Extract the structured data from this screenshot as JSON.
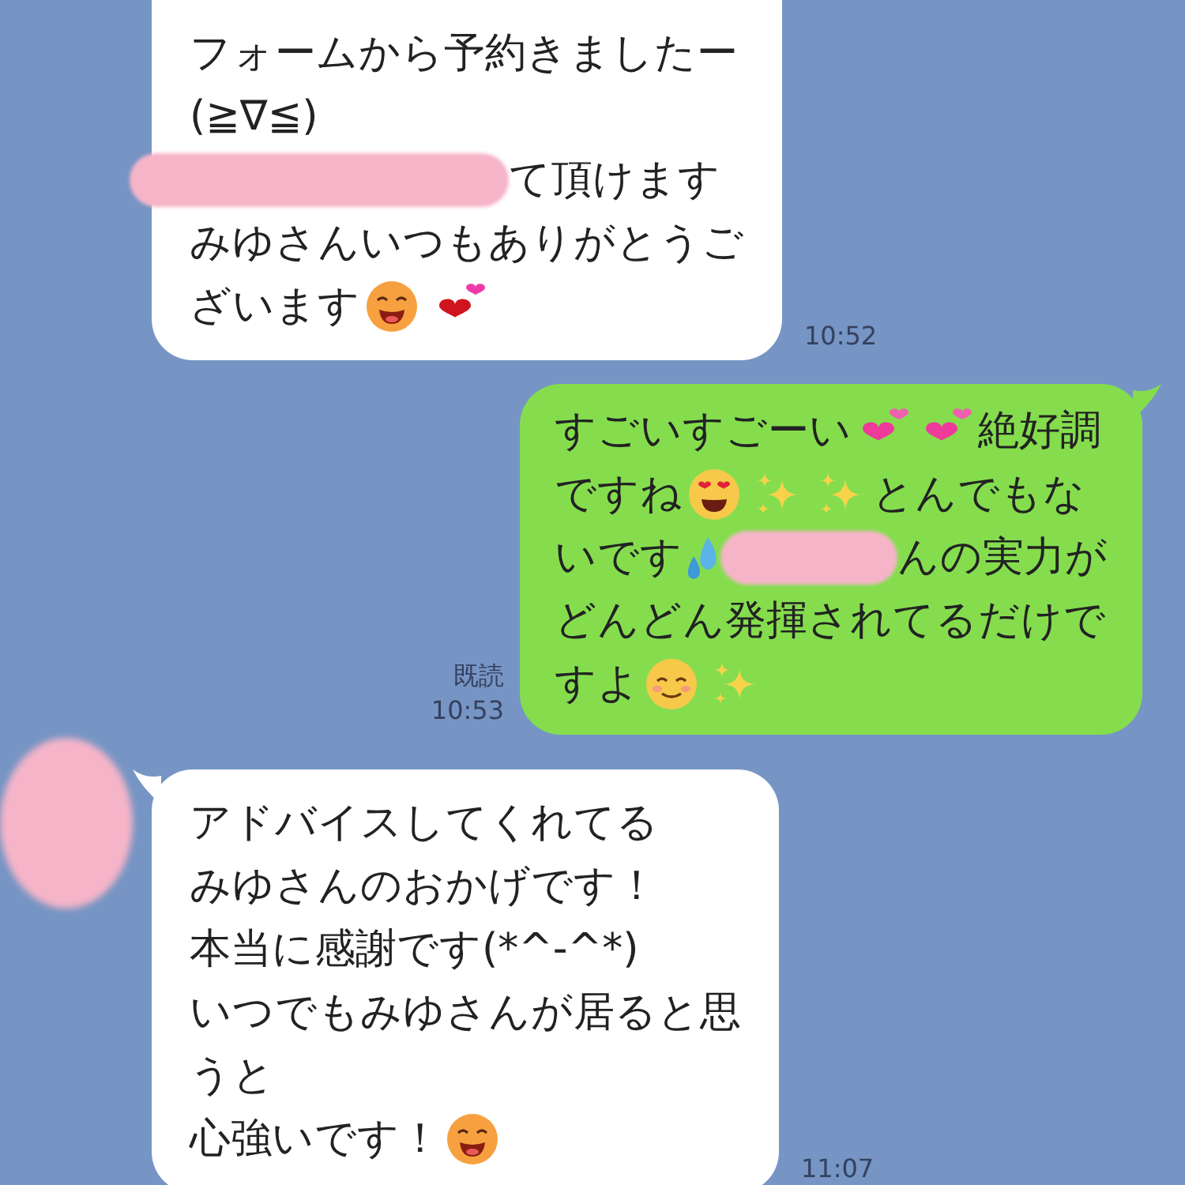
{
  "messages": [
    {
      "kind": "incoming",
      "tail": false,
      "avatar": false,
      "time": "10:52",
      "lines": [
        [
          {
            "kind": "text",
            "text": "フォームから予約きましたー"
          }
        ],
        [
          {
            "kind": "text",
            "text": "(≧∇≦)"
          }
        ],
        [
          {
            "kind": "blot"
          },
          {
            "kind": "text",
            "text": "て頂けます"
          }
        ],
        [
          {
            "kind": "text",
            "text": "みゆさんいつもありがとうご"
          }
        ],
        [
          {
            "kind": "text",
            "text": "ざいます"
          },
          {
            "kind": "grin"
          },
          {
            "kind": "hearts"
          }
        ]
      ]
    },
    {
      "kind": "outgoing",
      "tail": true,
      "avatar": false,
      "read": "既読",
      "time": "10:53",
      "lines": [
        [
          {
            "kind": "text",
            "text": "すごいすごーい"
          },
          {
            "kind": "pinkhearts"
          },
          {
            "kind": "pinkhearts"
          },
          {
            "kind": "text",
            "text": "絶好調"
          }
        ],
        [
          {
            "kind": "text",
            "text": "ですね"
          },
          {
            "kind": "hearteyes"
          },
          {
            "kind": "sparkles"
          },
          {
            "kind": "sparkles"
          },
          {
            "kind": "text",
            "text": "とんでもな"
          }
        ],
        [
          {
            "kind": "text",
            "text": "いです"
          },
          {
            "kind": "sweat"
          },
          {
            "kind": "blot"
          },
          {
            "kind": "text",
            "text": "んの実力が"
          }
        ],
        [
          {
            "kind": "text",
            "text": "どんどん発揮されてるだけで"
          }
        ],
        [
          {
            "kind": "text",
            "text": "すよ"
          },
          {
            "kind": "blush"
          },
          {
            "kind": "sparkles"
          }
        ]
      ]
    },
    {
      "kind": "incoming",
      "tail": true,
      "avatar": true,
      "time": "11:07",
      "lines": [
        [
          {
            "kind": "text",
            "text": "アドバイスしてくれてる"
          }
        ],
        [
          {
            "kind": "text",
            "text": "みゆさんのおかげです！"
          }
        ],
        [
          {
            "kind": "text",
            "text": "本当に感謝です(*^-^*)"
          }
        ],
        [
          {
            "kind": "text",
            "text": "いつでもみゆさんが居ると思"
          }
        ],
        [
          {
            "kind": "text",
            "text": "うと"
          }
        ],
        [
          {
            "kind": "text",
            "text": "心強いです！"
          },
          {
            "kind": "grin"
          }
        ]
      ]
    }
  ]
}
